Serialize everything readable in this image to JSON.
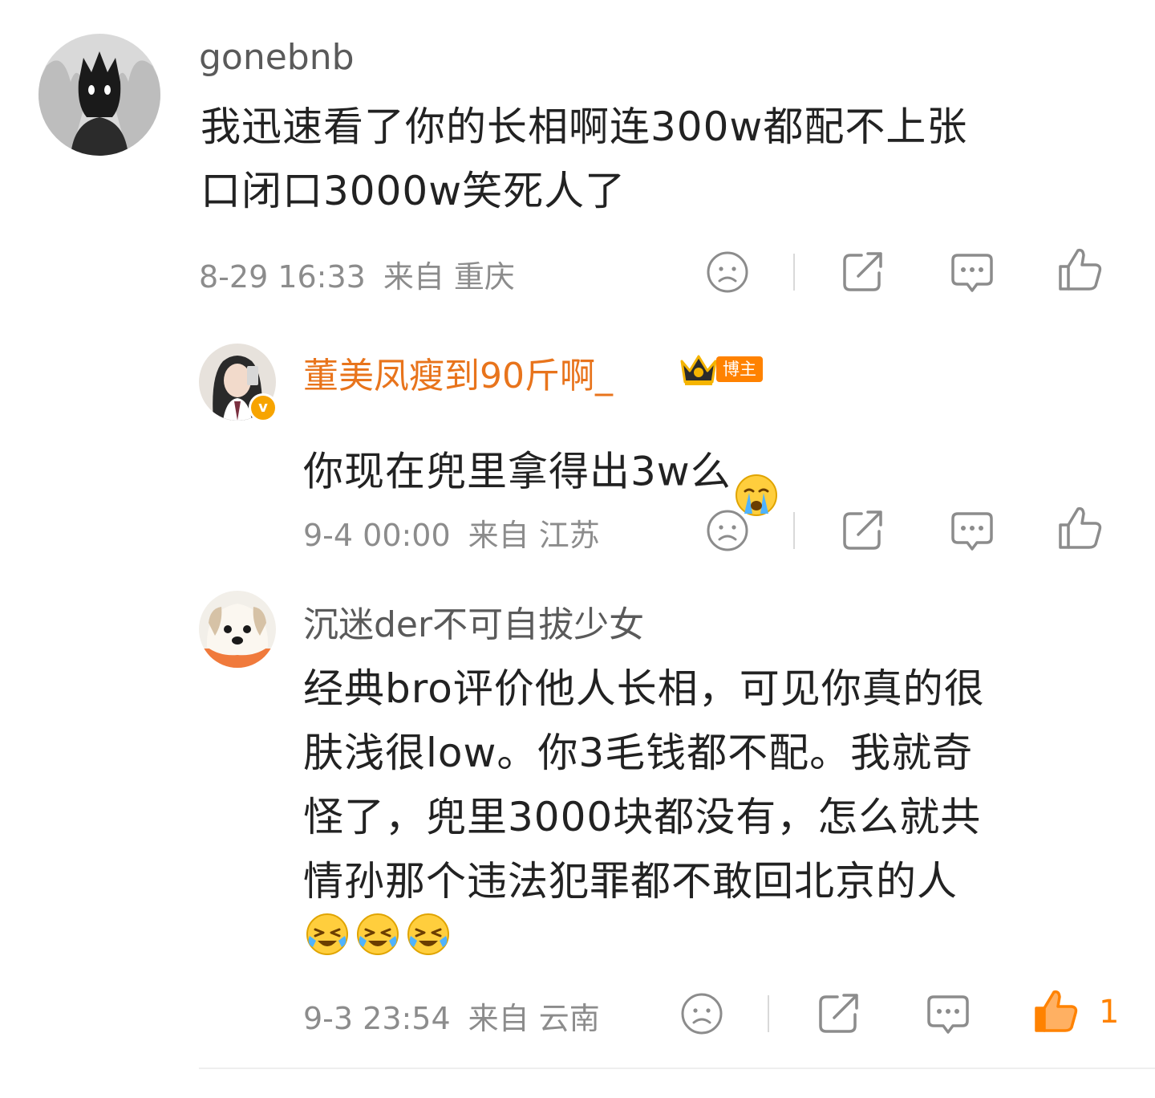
{
  "comments": [
    {
      "username": "gonebnb",
      "text": "我迅速看了你的长相啊连300w都配不上张\n口闭口3000w笑死人了",
      "time": "8-29 16:33",
      "source": "来自 重庆"
    },
    {
      "username": "董美凤瘦到90斤啊_",
      "badge": "博主",
      "text": "你现在兜里拿得出3w么",
      "time": "9-4 00:00",
      "source": "来自 江苏"
    },
    {
      "username": "沉迷der不可自拔少女",
      "text": "经典bro评价他人长相，可见你真的很\n肤浅很low。你3毛钱都不配。我就奇\n怪了，兜里3000块都没有，怎么就共\n情孙那个违法犯罪都不敢回北京的人",
      "time": "9-3 23:54",
      "source": "来自 云南",
      "likes": "1"
    }
  ],
  "colors": {
    "text": "#222222",
    "meta": "#8c8c8c",
    "username": "#5a5a5a",
    "creator_name": "#e8741c",
    "accent": "#ff8200",
    "icon": "#8c8c8c"
  },
  "icons": [
    "dislike-icon",
    "share-icon",
    "comment-icon",
    "like-icon",
    "crying-emoji",
    "laughing-emoji"
  ]
}
